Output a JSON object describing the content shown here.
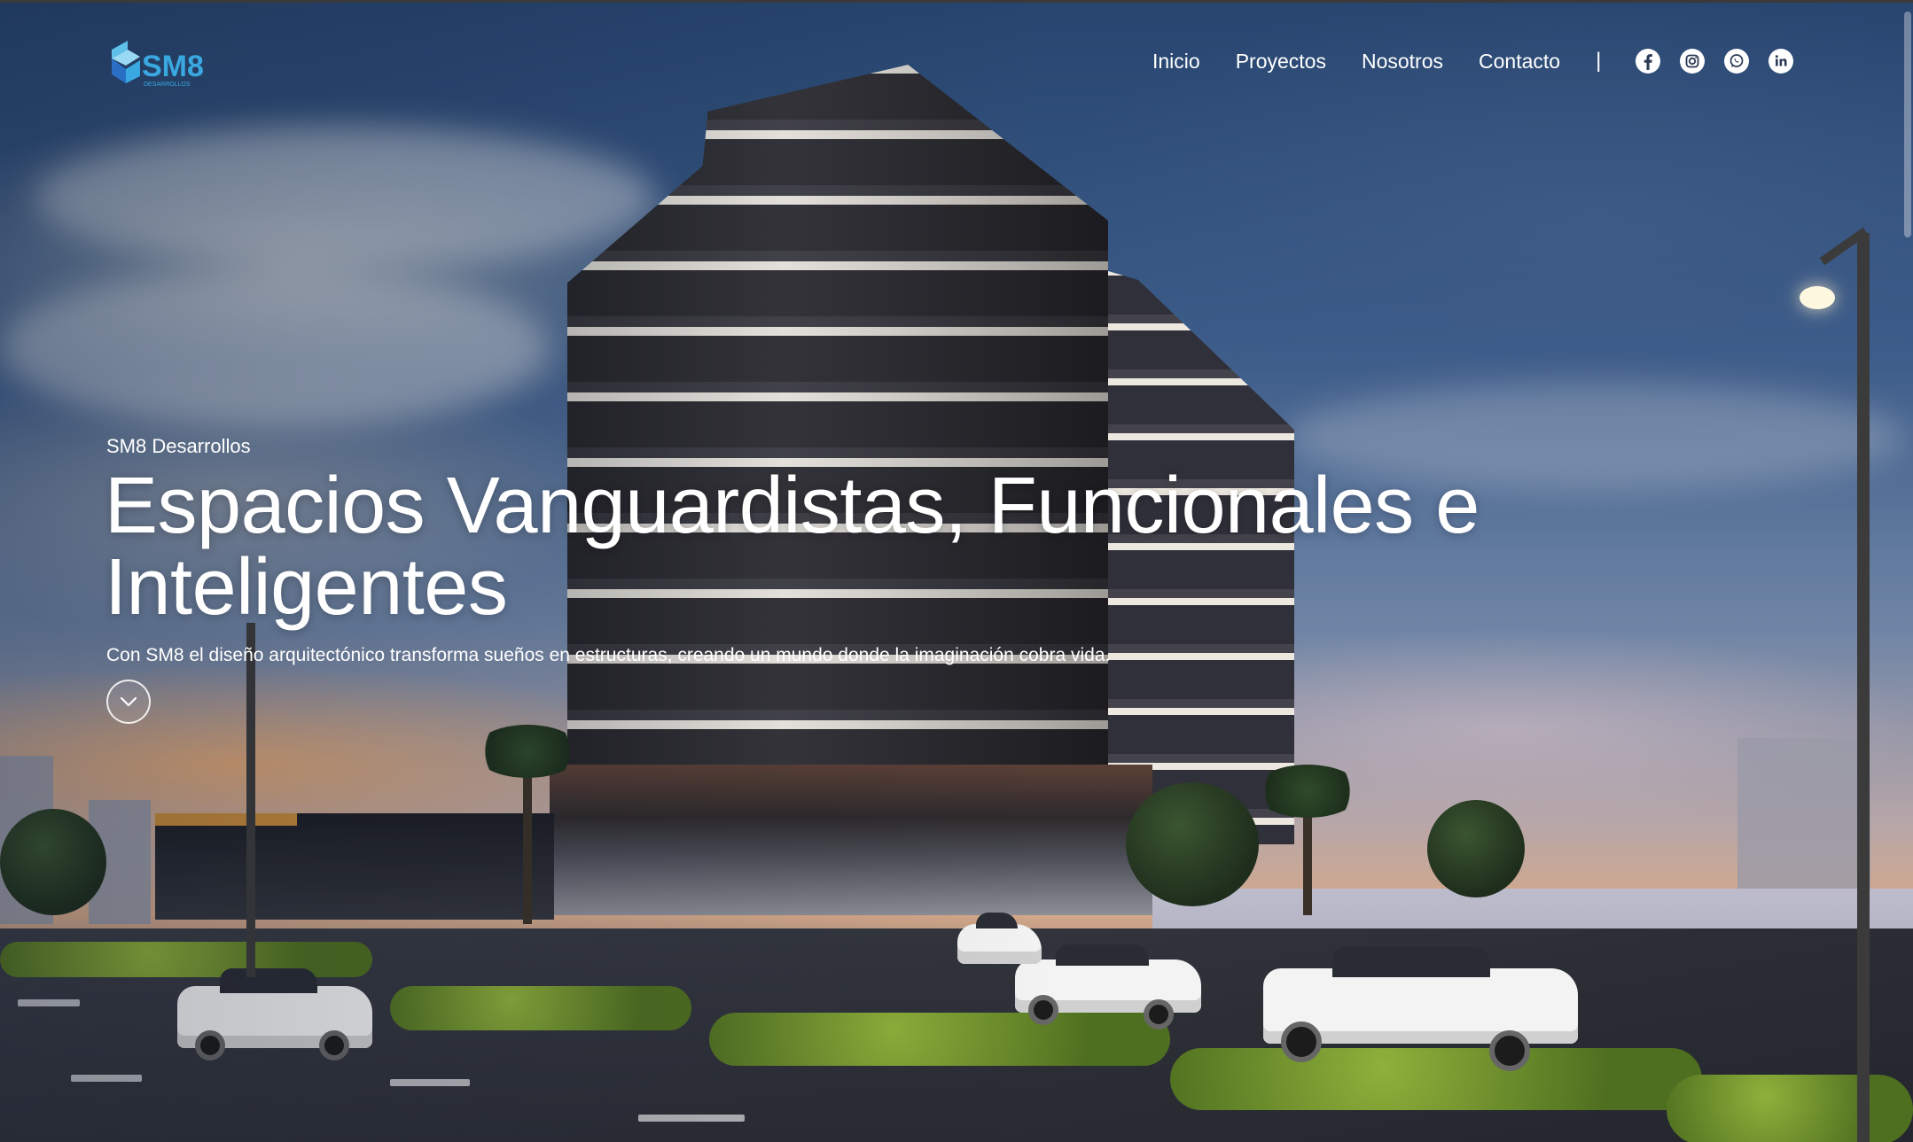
{
  "brand": {
    "logo_text": "SM8",
    "logo_subtext": "DESARROLLOS",
    "accent_color": "#3aa8e0"
  },
  "nav": {
    "items": [
      {
        "label": "Inicio"
      },
      {
        "label": "Proyectos"
      },
      {
        "label": "Nosotros"
      },
      {
        "label": "Contacto"
      }
    ],
    "separator": "|",
    "social_icons": [
      "facebook-icon",
      "instagram-icon",
      "whatsapp-icon",
      "linkedin-icon"
    ]
  },
  "hero": {
    "eyebrow": "SM8 Desarrollos",
    "headline_line1": "Espacios Vanguardistas, Funcionales e",
    "headline_line2": "Inteligentes",
    "subtitle": "Con SM8 el diseño arquitectónico transforma sueños en estructuras, creando un mundo donde la imaginación cobra vida.",
    "scroll_icon": "chevron-down-icon"
  }
}
